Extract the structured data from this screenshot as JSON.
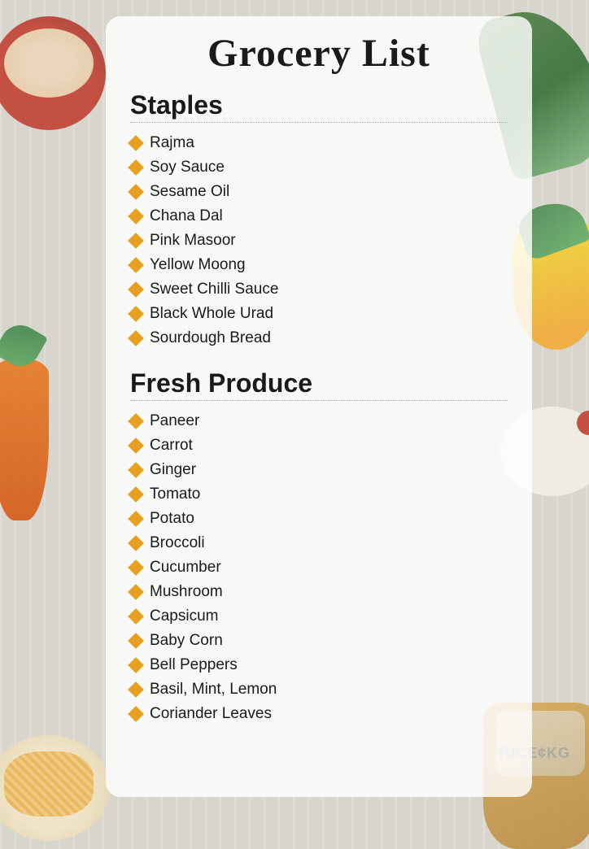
{
  "page": {
    "title": "Grocery List",
    "background_note": "striped gray background with food illustrations"
  },
  "sections": [
    {
      "id": "staples",
      "title": "Staples",
      "items": [
        "Rajma",
        "Soy Sauce",
        "Sesame Oil",
        "Chana Dal",
        "Pink Masoor",
        "Yellow Moong",
        "Sweet Chilli Sauce",
        "Black Whole Urad",
        "Sourdough Bread"
      ]
    },
    {
      "id": "fresh-produce",
      "title": "Fresh Produce",
      "items": [
        "Paneer",
        "Carrot",
        "Ginger",
        "Tomato",
        "Potato",
        "Broccoli",
        "Cucumber",
        "Mushroom",
        "Capsicum",
        "Baby Corn",
        "Bell Peppers",
        "Basil, Mint, Lemon",
        "Coriander Leaves"
      ]
    }
  ]
}
